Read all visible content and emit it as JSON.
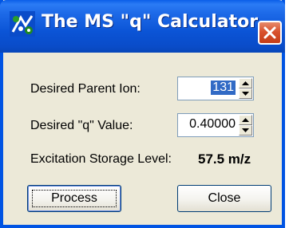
{
  "window": {
    "title": "The MS \"q\" Calculator",
    "icon": "app-icon"
  },
  "titlebar": {
    "close_icon": "close-icon"
  },
  "form": {
    "parent_ion_label": "Desired Parent Ion:",
    "parent_ion_value": "131",
    "q_label": "Desired \"q\" Value:",
    "q_value": "0.40000",
    "storage_label": "Excitation Storage Level:",
    "storage_value": "57.5 m/z"
  },
  "buttons": {
    "process_label": "Process",
    "close_label": "Close"
  },
  "colors": {
    "titlebar": "#0a4cc9",
    "close_button": "#d9522e",
    "dialog_bg": "#ece9d8",
    "selection": "#316ac5"
  }
}
